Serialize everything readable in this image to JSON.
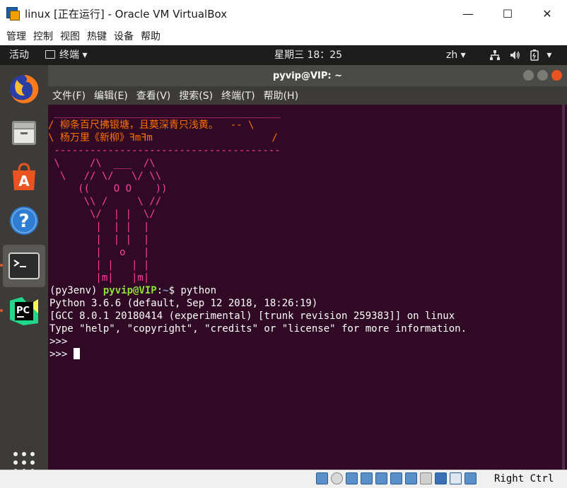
{
  "host_window": {
    "title": "linux [正在运行] - Oracle VM VirtualBox",
    "controls": {
      "minimize": "—",
      "maximize": "☐",
      "close": "✕"
    },
    "menu": [
      "管理",
      "控制",
      "视图",
      "热键",
      "设备",
      "帮助"
    ]
  },
  "ubuntu": {
    "activities": "活动",
    "app_menu": "终端 ▾",
    "clock": "星期三 18：25",
    "lang": "zh ▾",
    "tray_icons": [
      "network-icon",
      "volume-icon",
      "battery-icon",
      "power-menu-icon"
    ]
  },
  "dock_apps": [
    {
      "name": "firefox",
      "icon": "firefox-icon"
    },
    {
      "name": "files",
      "icon": "files-icon"
    },
    {
      "name": "software",
      "icon": "ubuntu-software-icon"
    },
    {
      "name": "help",
      "icon": "help-icon"
    },
    {
      "name": "terminal",
      "icon": "terminal-icon",
      "active": true
    },
    {
      "name": "pycharm",
      "icon": "pycharm-icon"
    },
    {
      "name": "show-apps",
      "icon": "app-grid-icon"
    }
  ],
  "terminal": {
    "title": "pyvip@VIP: ~",
    "menu": [
      "文件(F)",
      "编辑(E)",
      "查看(V)",
      "搜索(S)",
      "终端(T)",
      "帮助(H)"
    ],
    "art": {
      "top_border": " ______________________________________",
      "line1": "/ 柳条百尺拂银塘，且莫深青只浅黄。  -- \\",
      "line2": "\\ 杨万里《新柳》ꟻmꟻm                    /",
      "bottom_border": " --------------------------------------",
      "owl": [
        " \\     /\\  ___  /\\",
        "  \\   // \\/   \\/ \\\\",
        "     ((    O O    ))",
        "      \\\\ /     \\ //",
        "       \\/  | |  \\/",
        "        |  | |  |",
        "        |  | |  |",
        "        |   o   |",
        "        | |   | |",
        "        |m|   |m|"
      ]
    },
    "prompt_env": "(py3env) ",
    "prompt_user": "pyvip@VIP",
    "prompt_path": "~",
    "prompt_symbol": "$ ",
    "command": "python",
    "output": [
      "Python 3.6.6 (default, Sep 12 2018, 18:26:19)",
      "[GCC 8.0.1 20180414 (experimental) [trunk revision 259383]] on linux",
      "Type \"help\", \"copyright\", \"credits\" or \"license\" for more information.",
      ">>>"
    ],
    "current_prompt": ">>> "
  },
  "vbox_status": {
    "host_key": "Right Ctrl"
  }
}
